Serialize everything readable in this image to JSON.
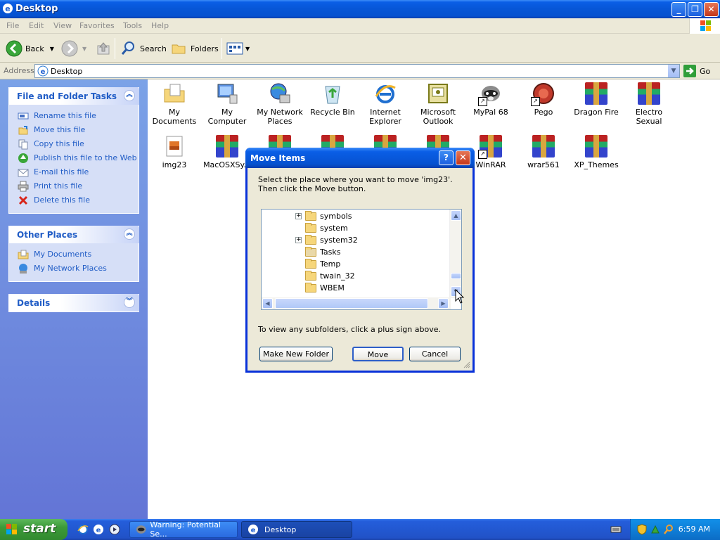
{
  "window": {
    "title": "Desktop"
  },
  "menu": [
    "File",
    "Edit",
    "View",
    "Favorites",
    "Tools",
    "Help"
  ],
  "toolbar": {
    "back": "Back",
    "search": "Search",
    "folders": "Folders"
  },
  "address": {
    "label": "Address",
    "value": "Desktop",
    "go": "Go"
  },
  "sidebar": {
    "file_tasks": {
      "title": "File and Folder Tasks",
      "items": [
        "Rename this file",
        "Move this file",
        "Copy this file",
        "Publish this file to the Web",
        "E-mail this file",
        "Print this file",
        "Delete this file"
      ]
    },
    "other_places": {
      "title": "Other Places",
      "items": [
        "My Documents",
        "My Network Places"
      ]
    },
    "details": {
      "title": "Details"
    }
  },
  "desktop_icons": [
    {
      "label": "My Documents",
      "icon": "my-documents-icon"
    },
    {
      "label": "My Computer",
      "icon": "my-computer-icon"
    },
    {
      "label": "My Network Places",
      "icon": "network-places-icon"
    },
    {
      "label": "Recycle Bin",
      "icon": "recycle-bin-icon"
    },
    {
      "label": "Internet Explorer",
      "icon": "internet-explorer-icon"
    },
    {
      "label": "Microsoft Outlook",
      "icon": "outlook-icon"
    },
    {
      "label": "MyPal 68",
      "icon": "mypal-icon"
    },
    {
      "label": "Pego",
      "icon": "pego-icon"
    },
    {
      "label": "Dragon Fire",
      "icon": "winrar-archive-icon"
    },
    {
      "label": "Electro Sexual",
      "icon": "winrar-archive-icon"
    },
    {
      "label": "img23",
      "icon": "image-file-icon"
    },
    {
      "label": "MacOSXSy...",
      "icon": "winrar-archive-icon"
    },
    {
      "label": "WinRAR",
      "icon": "winrar-icon"
    },
    {
      "label": "wrar561",
      "icon": "winrar-archive-icon"
    },
    {
      "label": "XP_Themes",
      "icon": "winrar-archive-icon"
    }
  ],
  "dialog": {
    "title": "Move Items",
    "instruction": "Select the place where you want to move 'img23'. Then click the Move button.",
    "tree_items": [
      {
        "label": "symbols",
        "expandable": true
      },
      {
        "label": "system",
        "expandable": false
      },
      {
        "label": "system32",
        "expandable": true
      },
      {
        "label": "Tasks",
        "expandable": false
      },
      {
        "label": "Temp",
        "expandable": false
      },
      {
        "label": "twain_32",
        "expandable": false
      },
      {
        "label": "WBEM",
        "expandable": false
      }
    ],
    "hint": "To view any subfolders, click a plus sign above.",
    "buttons": {
      "new_folder": "Make New Folder",
      "move": "Move",
      "cancel": "Cancel"
    }
  },
  "taskbar": {
    "start": "start",
    "tasks": [
      "Warning: Potential Se...",
      "Desktop"
    ],
    "clock": "6:59 AM"
  }
}
